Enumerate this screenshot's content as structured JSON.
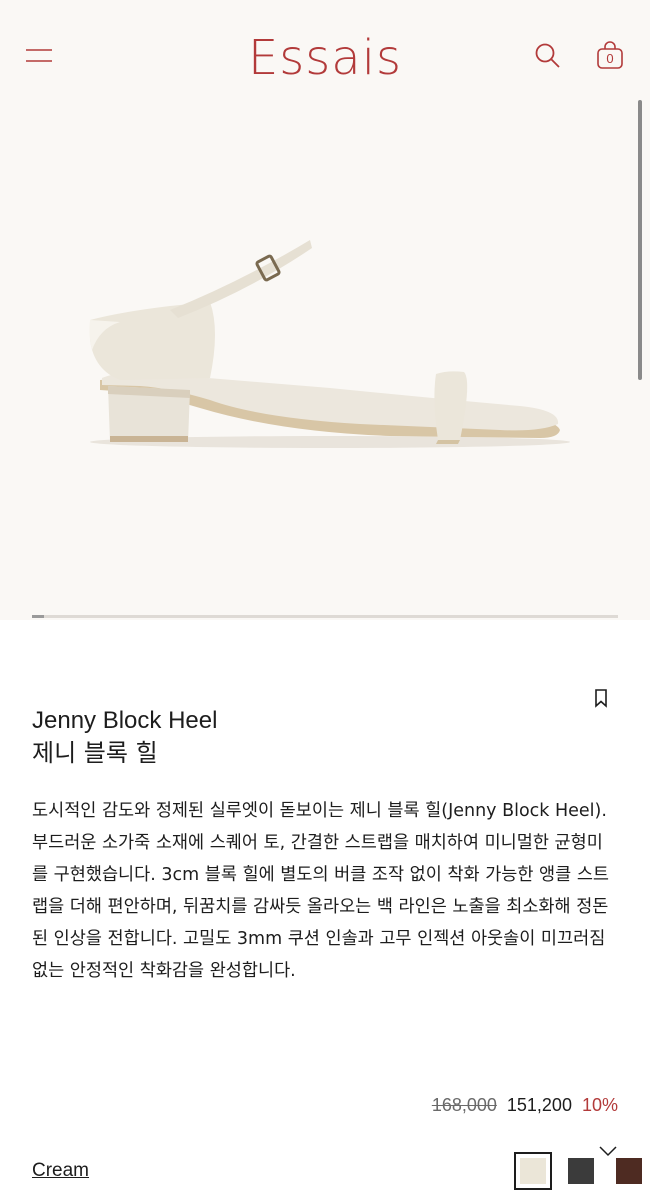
{
  "header": {
    "logo": "Essais",
    "cart_count": "0"
  },
  "product": {
    "name_en": "Jenny Block Heel",
    "name_ko": "제니 블록 힐",
    "description": "도시적인 감도와 정제된 실루엣이 돋보이는 제니 블록 힐(Jenny Block Heel).\n부드러운 소가죽 소재에 스퀘어 토, 간결한 스트랩을 매치하여 미니멀한 균형미를 구현했습니다. 3cm 블록 힐에 별도의 버클 조작 없이 착화 가능한 앵클 스트랩을 더해 편안하며, 뒤꿈치를 감싸듯 올라오는 백 라인은 노출을 최소화해 정돈된 인상을 전합니다. 고밀도 3mm 쿠션 인솔과 고무 인젝션 아웃솔이 미끄러짐 없는 안정적인 착화감을 완성합니다.",
    "original_price": "168,000",
    "sale_price": "151,200",
    "discount": "10%",
    "selected_color": "Cream",
    "colors": [
      {
        "name": "Cream",
        "hex": "#ebe6d8",
        "selected": true
      },
      {
        "name": "Charcoal",
        "hex": "#3b3b3b",
        "selected": false
      },
      {
        "name": "Brown",
        "hex": "#4e2b22",
        "selected": false
      }
    ]
  },
  "gallery": {
    "progress": 0.02
  },
  "theme": {
    "accent": "#b23a3a",
    "hero_bg": "#faf8f5"
  }
}
